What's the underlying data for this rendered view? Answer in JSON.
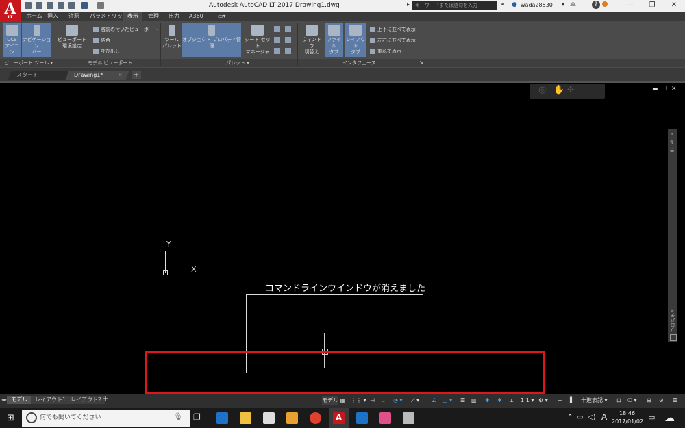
{
  "window": {
    "title": "Autodesk AutoCAD LT 2017    Drawing1.dwg",
    "search_placeholder": "キーワードまたは語句を入力",
    "user": "wada28530",
    "logo_sub": "LT"
  },
  "ribbon": {
    "tabs": [
      "ホーム",
      "挿入",
      "注釈",
      "パラメトリック",
      "表示",
      "管理",
      "出力",
      "A360"
    ],
    "active_tab": "表示",
    "panels": {
      "viewport_tools": {
        "label": "ビューポート ツール",
        "ucs_icon": [
          "UCS",
          "アイコン"
        ],
        "navbar": [
          "ナビゲーション",
          "バー"
        ]
      },
      "model_viewports": {
        "label": "モデル ビューポート",
        "config": [
          "ビューポート",
          "環境設定"
        ],
        "named": "名前の付いたビューポート",
        "join": "結合",
        "restore": "呼び出し"
      },
      "palettes": {
        "label": "パレット",
        "tool_palettes": [
          "ツール",
          "パレット"
        ],
        "properties": "オブジェクト プロパティ管理",
        "sheetset": [
          "シート セット",
          "マネージャ"
        ]
      },
      "interface": {
        "label": "インタフェース",
        "switch_windows": [
          "ウィンドウ",
          "切替え"
        ],
        "file_tabs": [
          "ファイル",
          "タブ"
        ],
        "layout_tabs": [
          "レイアウト",
          "タブ"
        ],
        "tile_h": "上下に並べて表示",
        "tile_v": "左右に並べて表示",
        "cascade": "重ねて表示"
      }
    }
  },
  "doc_tabs": [
    {
      "label": "スタート",
      "active": false
    },
    {
      "label": "Drawing1*",
      "active": true
    }
  ],
  "canvas": {
    "ucs_y": "Y",
    "ucs_x": "X",
    "annotation": "コマンドラインウインドウが消えました",
    "properties_palette": "プロパティ"
  },
  "layout_tabs": [
    "モデル",
    "レイアウト1",
    "レイアウト2"
  ],
  "status": {
    "model": "モデル",
    "scale": "1:1",
    "units": "十進表記"
  },
  "taskbar": {
    "search_placeholder": "何でも聞いてください",
    "ime": "A",
    "time": "18:46",
    "date": "2017/01/02"
  },
  "colors": {
    "highlight_box": "#e0161b",
    "ribbon_bg": "#4b4b4b",
    "canvas_bg": "#000000"
  }
}
